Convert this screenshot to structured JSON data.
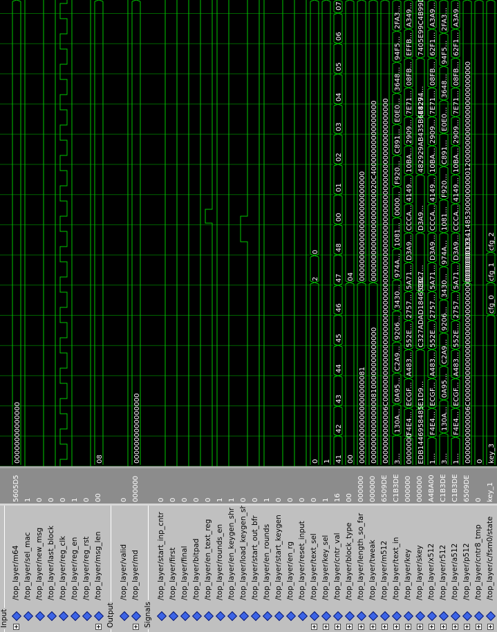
{
  "groups": {
    "input": "Input",
    "output": "Output",
    "signals": "Signals"
  },
  "signals": [
    {
      "id": "m64",
      "name": "/top_layer/m64",
      "value": "5605D5",
      "bus": true
    },
    {
      "id": "sel_mac",
      "name": "/top_layer/sel_mac",
      "value": "1",
      "bus": false
    },
    {
      "id": "new_msg",
      "name": "/top_layer/new_msg",
      "value": "0",
      "bus": false
    },
    {
      "id": "last_block",
      "name": "/top_layer/last_block",
      "value": "0",
      "bus": false
    },
    {
      "id": "reg_clk",
      "name": "/top_layer/reg_clk",
      "value": "0",
      "bus": false
    },
    {
      "id": "reg_en",
      "name": "/top_layer/reg_en",
      "value": "1",
      "bus": false
    },
    {
      "id": "reg_rst",
      "name": "/top_layer/reg_rst",
      "value": "0",
      "bus": false
    },
    {
      "id": "msg_len",
      "name": "/top_layer/msg_len",
      "value": "00",
      "bus": true
    },
    {
      "id": "valid",
      "name": "/top_layer/valid",
      "value": "0",
      "bus": false
    },
    {
      "id": "md",
      "name": "/top_layer/md",
      "value": "000000",
      "bus": true
    },
    {
      "id": "start_inp_cntr",
      "name": "/top_layer/start_inp_cntr",
      "value": "0",
      "bus": false
    },
    {
      "id": "first",
      "name": "/top_layer/first",
      "value": "0",
      "bus": false
    },
    {
      "id": "final",
      "name": "/top_layer/final",
      "value": "0",
      "bus": false
    },
    {
      "id": "bitpad",
      "name": "/top_layer/bitpad",
      "value": "0",
      "bus": false
    },
    {
      "id": "en_text_reg",
      "name": "/top_layer/en_text_reg",
      "value": "0",
      "bus": false
    },
    {
      "id": "rounds_en",
      "name": "/top_layer/rounds_en",
      "value": "1",
      "bus": false
    },
    {
      "id": "en_keygen_shr",
      "name": "/top_layer/en_keygen_shr",
      "value": "1",
      "bus": false
    },
    {
      "id": "load_keygen_shr",
      "name": "/top_layer/load_keygen_shr",
      "value": "0",
      "bus": false
    },
    {
      "id": "start_out_bfr",
      "name": "/top_layer/start_out_bfr",
      "value": "0",
      "bus": false
    },
    {
      "id": "en_rounds",
      "name": "/top_layer/en_rounds",
      "value": "1",
      "bus": false
    },
    {
      "id": "start_keygen",
      "name": "/top_layer/start_keygen",
      "value": "0",
      "bus": false
    },
    {
      "id": "en_rg",
      "name": "/top_layer/en_rg",
      "value": "0",
      "bus": false
    },
    {
      "id": "reset_input",
      "name": "/top_layer/reset_input",
      "value": "0",
      "bus": false
    },
    {
      "id": "text_sel",
      "name": "/top_layer/text_sel",
      "value": "0",
      "bus": true
    },
    {
      "id": "key_sel",
      "name": "/top_layer/key_sel",
      "value": "1",
      "bus": true
    },
    {
      "id": "cntr_val",
      "name": "/top_layer/cntr_val",
      "value": "16",
      "bus": true
    },
    {
      "id": "block_type",
      "name": "/top_layer/block_type",
      "value": "00",
      "bus": true
    },
    {
      "id": "length_so_far",
      "name": "/top_layer/length_so_far",
      "value": "000000",
      "bus": true
    },
    {
      "id": "tweak",
      "name": "/top_layer/tweak",
      "value": "000000",
      "bus": true
    },
    {
      "id": "m512",
      "name": "/top_layer/m512",
      "value": "6509DE",
      "bus": true
    },
    {
      "id": "text_in",
      "name": "/top_layer/text_in",
      "value": "C1B3DE",
      "bus": true
    },
    {
      "id": "key",
      "name": "/top_layer/key",
      "value": "000000",
      "bus": true
    },
    {
      "id": "skey",
      "name": "/top_layer/skey",
      "value": "000000",
      "bus": true
    },
    {
      "id": "x512",
      "name": "/top_layer/x512",
      "value": "A4BA00",
      "bus": true
    },
    {
      "id": "r512",
      "name": "/top_layer/r512",
      "value": "C1B3DE",
      "bus": true
    },
    {
      "id": "a512",
      "name": "/top_layer/a512",
      "value": "C1B3DE",
      "bus": true
    },
    {
      "id": "p512",
      "name": "/top_layer/p512",
      "value": "6509DE",
      "bus": true
    },
    {
      "id": "cntr8_tmp",
      "name": "/top_layer/cntr8_tmp",
      "value": "0",
      "bus": true
    },
    {
      "id": "state",
      "name": "/top_layer/c/fsm0/state",
      "value": "key_1",
      "bus": true
    }
  ],
  "bus_labels": {
    "m64": [
      "00000000000000"
    ],
    "msg_len": [
      "08"
    ],
    "md": [
      "0000000000000000"
    ],
    "text_sel": [
      "0",
      "2",
      "0"
    ],
    "key_sel": [
      "1"
    ],
    "cntr_val": [
      "41",
      "42",
      "43",
      "44",
      "45",
      "46",
      "47",
      "48",
      "00",
      "01",
      "02",
      "03",
      "04",
      "05",
      "06",
      "07"
    ],
    "block_type": [
      "00",
      "04"
    ],
    "length_so_far": [
      "0000000000000000000081",
      "0000000000000000000000000"
    ],
    "tweak": [
      "0000000000000008100000000000000",
      "00000000000000000000020C40000000000000000"
    ],
    "m512": [
      "0000000000006C000000000000000000000000000000000000000000000000000000000000000000000"
    ],
    "text_in": [
      "3...",
      "130A...",
      "0A95...",
      "C2A9...",
      "9206...",
      "3430...",
      "974A...",
      "1081...",
      "0000...",
      "F920...",
      "C891...",
      "E0E0...",
      "3648...",
      "94F5...",
      "2FA3..."
    ],
    "key": [
      "0000000",
      "F4E4...",
      "ECGF...",
      "A483...",
      "552E...",
      "2757...",
      "5A71...",
      "D3A9...",
      "CCCA...",
      "4149...",
      "10BA...",
      "2909...",
      "7E71...",
      "08FB...",
      "EFFB...",
      "A349..."
    ],
    "skey": [
      "EDB1446958485...",
      "E1D9...",
      "C327ADAD1846580...",
      "C327...",
      "D3A9...",
      "482929AB435B6E4274...",
      "4829...",
      "7405E99C4B99D8885..."
    ],
    "x512": [
      "1...",
      "F4E4...",
      "ECGF...",
      "A483...",
      "552E...",
      "2757...",
      "5A71...",
      "D3A9...",
      "CCCA...",
      "4149...",
      "10BA...",
      "2909...",
      "7E71...",
      "08FB...",
      "62F1...",
      "A3A9..."
    ],
    "r512": [
      "3...",
      "130A...",
      "0A95...",
      "C2A9...",
      "9206...",
      "3430...",
      "974A...",
      "1081...",
      "F920...",
      "C891...",
      "E0E0...",
      "3648...",
      "94F5...",
      "2FA3..."
    ],
    "a512": [
      "1...",
      "F4E4...",
      "ECGF...",
      "A483...",
      "552E...",
      "2757...",
      "5A71...",
      "D3A9...",
      "CCCA...",
      "4149...",
      "10BA...",
      "2909...",
      "7E71...",
      "08FB...",
      "62F1...",
      "A3A9..."
    ],
    "p512": [
      "0000000000006C0000000000000000000000000000000000000...",
      "00000001334148530000000001200000000000000000000000"
    ],
    "cntr8_tmp": [
      "0"
    ],
    "state": [
      "key_3",
      "cfg_0",
      "cfg_1",
      "cfg_2"
    ]
  },
  "colors": {
    "wave": "#00c800",
    "grid": "#006400",
    "text": "#ffffff",
    "names_bg": "#c0c0c0",
    "values_bg": "#8c8c8c"
  }
}
